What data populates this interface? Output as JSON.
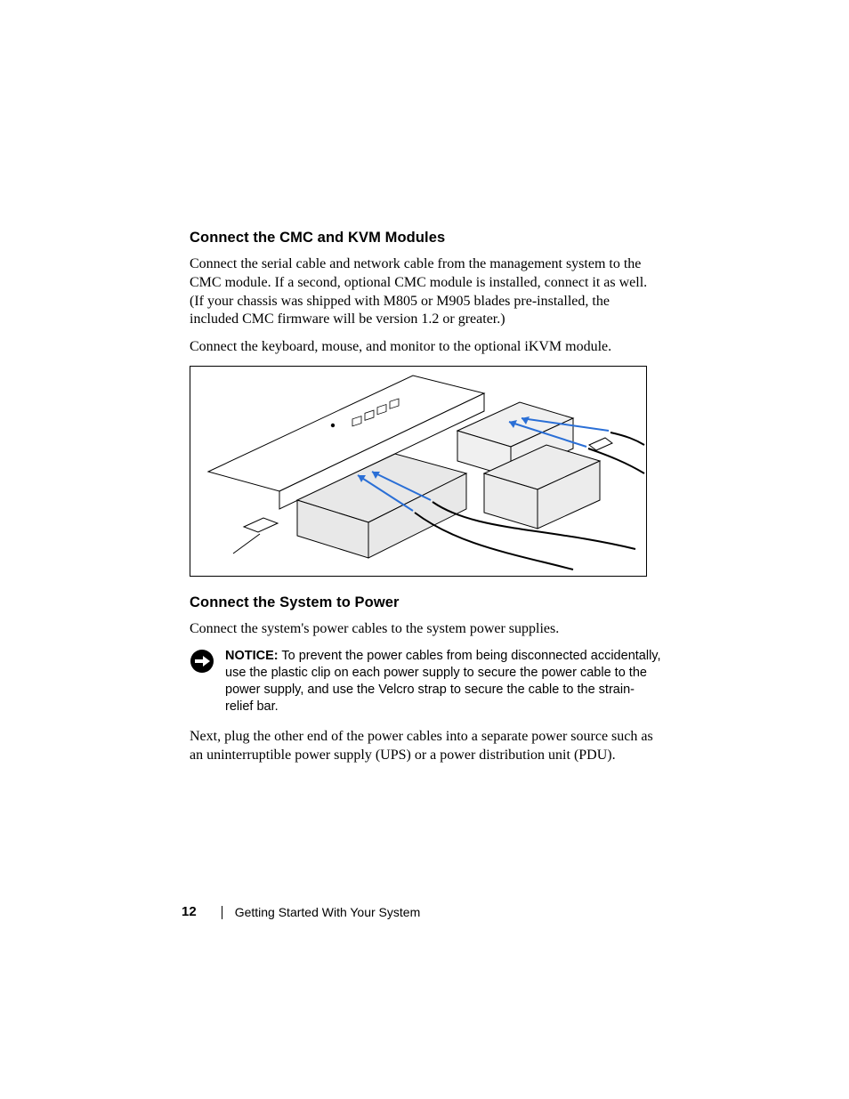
{
  "sections": {
    "s1": {
      "heading": "Connect the CMC and KVM Modules",
      "p1": "Connect the serial cable and network cable from the management system to the CMC module. If a second, optional CMC module is installed, connect it as well. (If your chassis was shipped with M805 or M905 blades pre-installed, the included CMC firmware will be version 1.2 or greater.)",
      "p2": "Connect the keyboard, mouse, and monitor to the optional iKVM module."
    },
    "s2": {
      "heading": "Connect the System to Power",
      "p1": "Connect the system's power cables to the system power supplies.",
      "notice_label": "NOTICE:",
      "notice_body": " To prevent the power cables from being disconnected accidentally, use the plastic clip on each power supply to secure the power cable to the power supply, and use the Velcro strap to secure the cable to the strain-relief bar.",
      "p2": "Next, plug the other end of the power cables into a separate power source such as an uninterruptible power supply (UPS) or a power distribution unit (PDU)."
    }
  },
  "footer": {
    "page_number": "12",
    "title": "Getting Started With Your System"
  }
}
